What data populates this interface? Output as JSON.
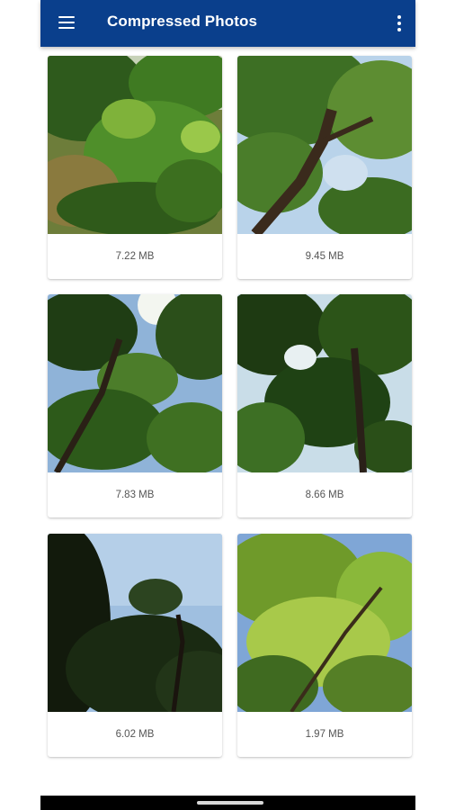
{
  "appbar": {
    "title": "Compressed Photos",
    "menu_icon": "hamburger-menu-icon",
    "overflow_icon": "more-vert-icon",
    "color": "#0a3f8c"
  },
  "photos": [
    {
      "size": "7.22 MB"
    },
    {
      "size": "9.45 MB"
    },
    {
      "size": "7.83 MB"
    },
    {
      "size": "8.66 MB"
    },
    {
      "size": "6.02 MB"
    },
    {
      "size": "1.97 MB"
    }
  ]
}
